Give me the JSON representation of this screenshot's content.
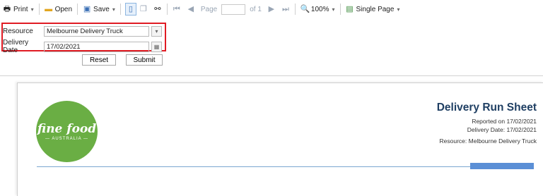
{
  "toolbar": {
    "print": "Print",
    "open": "Open",
    "save": "Save",
    "page_label": "Page",
    "page_value": "",
    "page_of": "of 1",
    "zoom": "100%",
    "view_mode": "Single Page"
  },
  "params": {
    "resource_label": "Resource",
    "resource_value": "Melbourne Delivery Truck",
    "date_label": "Delivery Date",
    "date_value": "17/02/2021",
    "reset": "Reset",
    "submit": "Submit"
  },
  "report": {
    "logo_main": "fine food",
    "logo_sub": "— AUSTRALIA —",
    "title": "Delivery Run Sheet",
    "reported_on": "Reported on 17/02/2021",
    "delivery_date": "Delivery Date: 17/02/2021",
    "resource": "Resource: Melbourne Delivery Truck"
  },
  "colors": {
    "highlight": "#e01b23",
    "logo_green": "#6aae44",
    "title_blue": "#1f3f63",
    "accent_blue": "#5b8fd6"
  }
}
